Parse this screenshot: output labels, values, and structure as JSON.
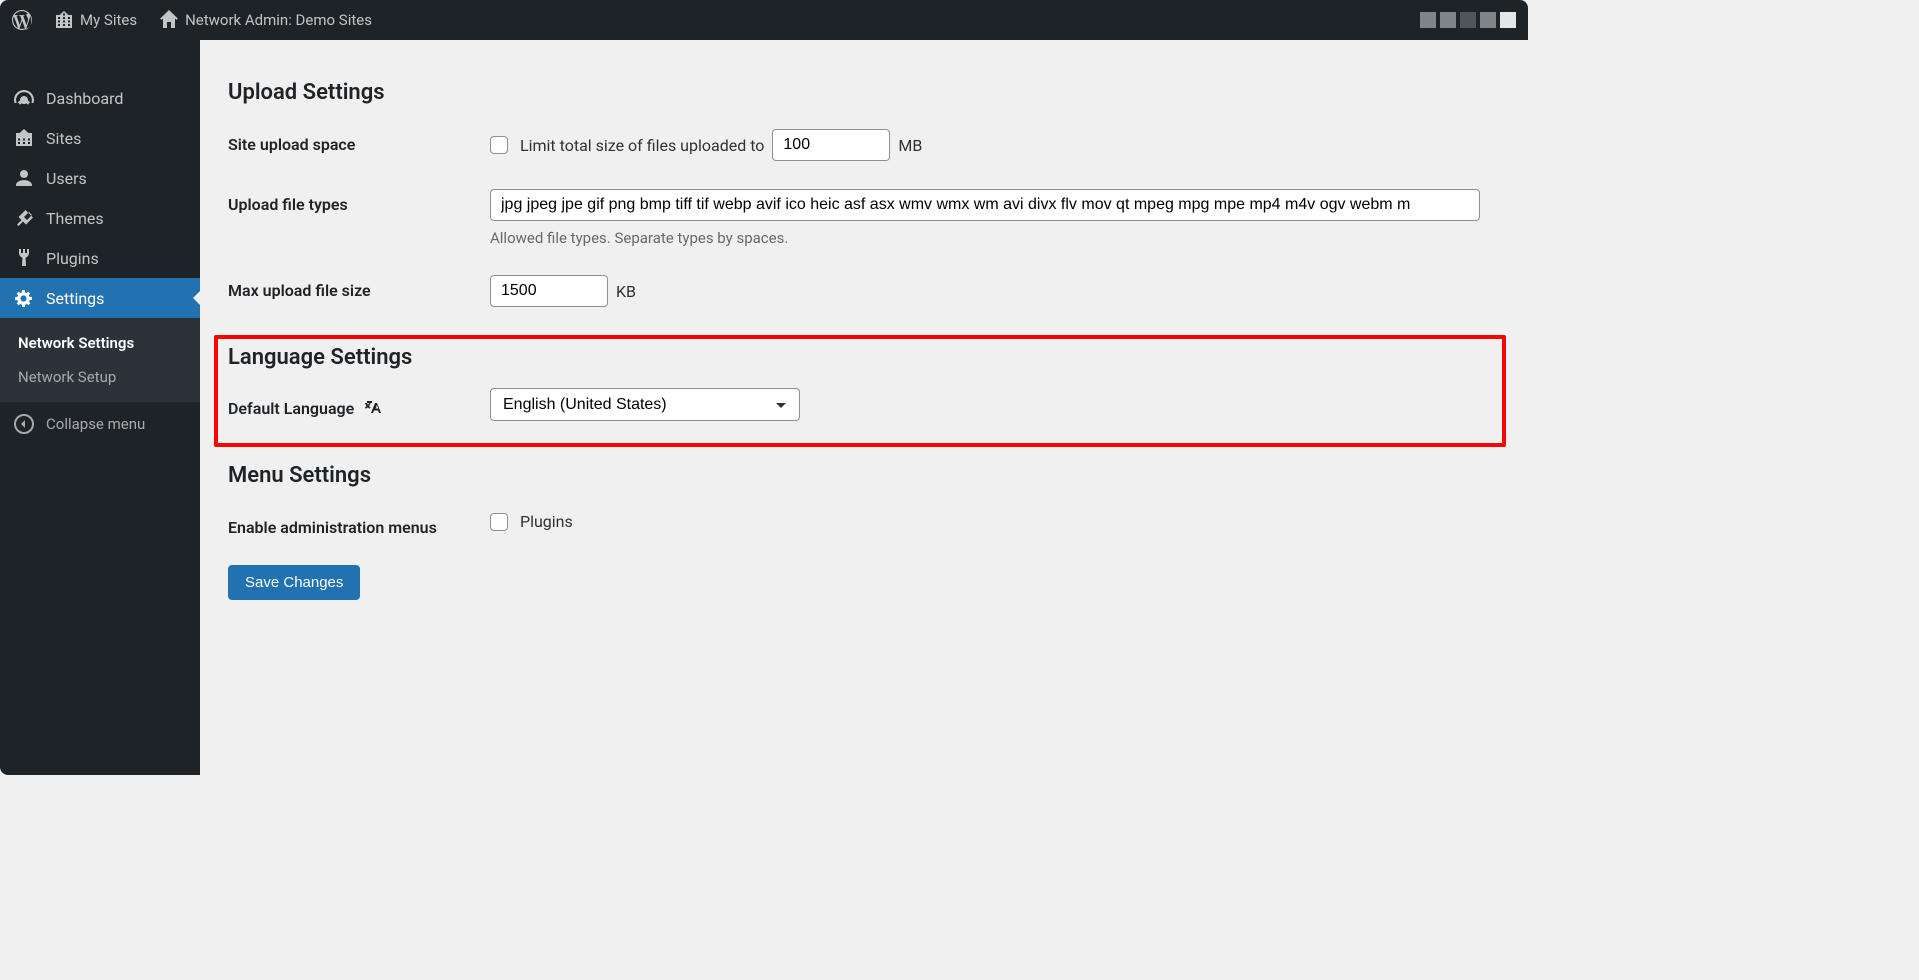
{
  "toolbar": {
    "my_sites": "My Sites",
    "network_admin": "Network Admin: Demo Sites"
  },
  "sidebar": {
    "items": [
      {
        "label": "Dashboard"
      },
      {
        "label": "Sites"
      },
      {
        "label": "Users"
      },
      {
        "label": "Themes"
      },
      {
        "label": "Plugins"
      },
      {
        "label": "Settings"
      }
    ],
    "submenu": [
      {
        "label": "Network Settings"
      },
      {
        "label": "Network Setup"
      }
    ],
    "collapse_label": "Collapse menu"
  },
  "sections": {
    "upload_title": "Upload Settings",
    "language_title": "Language Settings",
    "menu_title": "Menu Settings"
  },
  "upload": {
    "space_label": "Site upload space",
    "space_checkbox_label": "Limit total size of files uploaded to",
    "space_value": "100",
    "space_unit": "MB",
    "filetypes_label": "Upload file types",
    "filetypes_value": "jpg jpeg jpe gif png bmp tiff tif webp avif ico heic asf asx wmv wmx wm avi divx flv mov qt mpeg mpg mpe mp4 m4v ogv webm m",
    "filetypes_desc": "Allowed file types. Separate types by spaces.",
    "maxsize_label": "Max upload file size",
    "maxsize_value": "1500",
    "maxsize_unit": "KB"
  },
  "language": {
    "default_label": "Default Language",
    "selected": "English (United States)"
  },
  "menu": {
    "enable_label": "Enable administration menus",
    "plugins_label": "Plugins"
  },
  "save_button": "Save Changes"
}
